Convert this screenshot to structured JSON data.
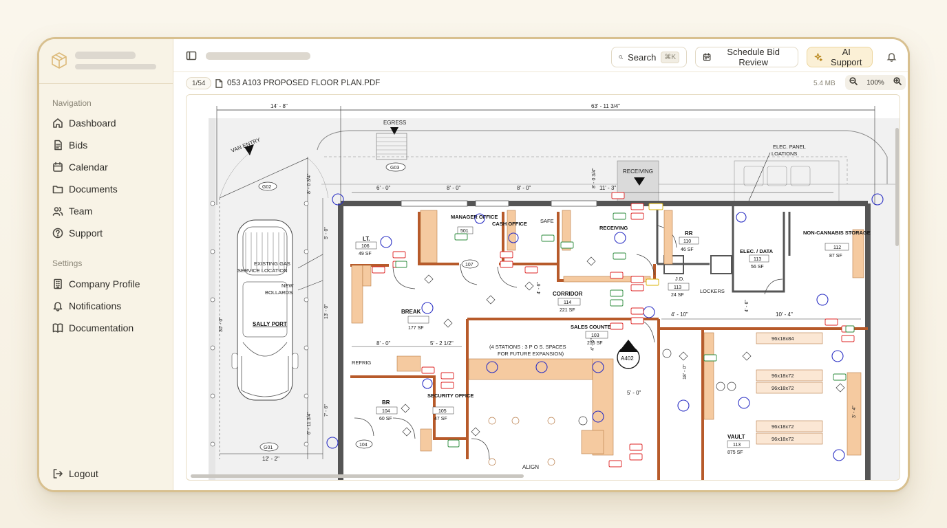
{
  "sidebar": {
    "nav_label": "Navigation",
    "nav_items": [
      {
        "label": "Dashboard",
        "icon": "home-icon"
      },
      {
        "label": "Bids",
        "icon": "file-text-icon"
      },
      {
        "label": "Calendar",
        "icon": "calendar-icon"
      },
      {
        "label": "Documents",
        "icon": "folder-icon"
      },
      {
        "label": "Team",
        "icon": "users-icon"
      },
      {
        "label": "Support",
        "icon": "help-circle-icon"
      }
    ],
    "settings_label": "Settings",
    "settings_items": [
      {
        "label": "Company Profile",
        "icon": "building-icon"
      },
      {
        "label": "Notifications",
        "icon": "bell-icon"
      },
      {
        "label": "Documentation",
        "icon": "book-icon"
      }
    ],
    "logout_label": "Logout"
  },
  "topbar": {
    "search_label": "Search",
    "search_shortcut": "⌘K",
    "schedule_label": "Schedule Bid Review",
    "ai_label": "AI Support"
  },
  "document": {
    "page_indicator": "1/54",
    "file_name": "053 A103 PROPOSED FLOOR PLAN.PDF",
    "file_size": "5.4 MB",
    "zoom": "100%"
  },
  "drawing": {
    "dim_top_left": "14' - 8\"",
    "dim_top_right": "63' - 11 3/4\"",
    "egress": "EGRESS",
    "van_entry": "VAN ENTRY",
    "receiving": "RECEIVING",
    "elec_panel": "ELEC. PANEL\nLOATIONS",
    "g01": "G01",
    "g02": "G02",
    "g03": "G03",
    "dim_6_0": "6' - 0\"",
    "dim_8_0a": "8' - 0\"",
    "dim_8_0b": "8' - 0\"",
    "dim_11_3": "11' - 3\"",
    "dim_12_2": "12' - 2\"",
    "dim_8_0c": "8' - 0\"",
    "dim_5_2": "5' - 2 1/2\"",
    "dim_4_10": "4' - 10\"",
    "dim_10_4": "10' - 4\"",
    "dim_5_0": "5' - 0\"",
    "existing_gas": "EXISTING GAS\nSERVICE LOCATION",
    "new_bollards": "NEW\nBOLLARDS",
    "sally_port": "SALLY PORT",
    "align": "ALIGN",
    "refrig": "REFRIG",
    "stations_note": "(4 STATIONS : 3 P O S. SPACES\nFOR FUTURE EXPANSION)",
    "lockers": "LOCKERS",
    "a402": "A402",
    "rooms": [
      {
        "name": "LT.",
        "num": "106",
        "area": "49 SF"
      },
      {
        "name": "MANAGER OFFICE",
        "num": "501",
        "area": ""
      },
      {
        "name": "CASH OFFICE",
        "num": "",
        "area": ""
      },
      {
        "name": "SAFE",
        "num": "",
        "area": ""
      },
      {
        "name": "RECEIVING",
        "num": "",
        "area": ""
      },
      {
        "name": "RR",
        "num": "110",
        "area": "46 SF"
      },
      {
        "name": "NON-CANNABIS STORAGE",
        "num": "112",
        "area": "87 SF"
      },
      {
        "name": "ELEC. / DATA",
        "num": "113",
        "area": "56 SF"
      },
      {
        "name": "J.D.",
        "num": "113",
        "area": "24 SF"
      },
      {
        "name": "CORRIDOR",
        "num": "114",
        "area": "221 SF"
      },
      {
        "name": "BREAK",
        "num": "",
        "area": "177 SF"
      },
      {
        "name": "SALES COUNTER",
        "num": "103",
        "area": "216 SF"
      },
      {
        "name": "BR",
        "num": "104",
        "area": "60 SF"
      },
      {
        "name": "SECURITY OFFICE",
        "num": "105",
        "area": "47 SF"
      },
      {
        "name": "VAULT",
        "num": "113",
        "area": "875 SF"
      }
    ],
    "racks": [
      "96x18x84",
      "96x18x72",
      "96x18x72",
      "96x18x72",
      "96x18x72"
    ],
    "door_tag": "107",
    "door_tag_2": "104"
  }
}
